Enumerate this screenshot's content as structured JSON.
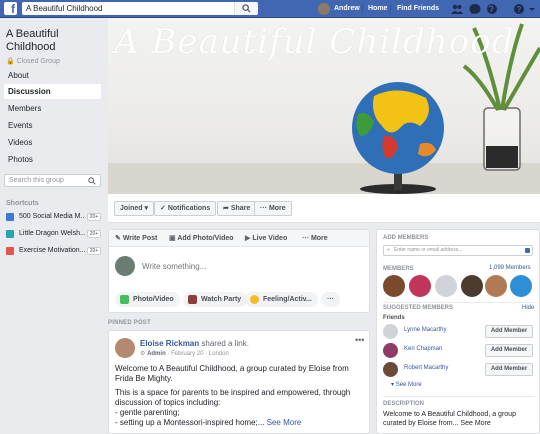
{
  "topbar": {
    "search_value": "A Beautiful Childhood",
    "user_name": "Andrew",
    "home_label": "Home",
    "find_friends_label": "Find Friends"
  },
  "sidebar": {
    "group_title": "A Beautiful Childhood",
    "privacy": "Closed Group",
    "nav": [
      "About",
      "Discussion",
      "Members",
      "Events",
      "Videos",
      "Photos"
    ],
    "search_placeholder": "Search this group",
    "shortcuts_title": "Shortcuts",
    "shortcuts": [
      {
        "label": "500 Social Media M...",
        "badge": "20+",
        "color": "#3b7bd6"
      },
      {
        "label": "Little Dragon Welsh...",
        "badge": "20+",
        "color": "#2aa3b6"
      },
      {
        "label": "Exercise Motivation...",
        "badge": "20+",
        "color": "#e6534a"
      }
    ]
  },
  "cover": {
    "title": "A Beautiful Childhood"
  },
  "actions": {
    "joined": "Joined",
    "notifications": "Notifications",
    "share": "Share",
    "more": "More"
  },
  "composer": {
    "tabs": [
      "Write Post",
      "Add Photo/Video",
      "Live Video",
      "More"
    ],
    "placeholder": "Write something...",
    "pills": [
      "Photo/Video",
      "Watch Party",
      "Feeling/Activ..."
    ]
  },
  "pinned": {
    "label": "PINNED POST",
    "author": "Eloise Rickman",
    "action": "shared a link.",
    "role": "Admin",
    "date": "February 20",
    "location": "London",
    "p1": "Welcome to A Beautiful Childhood, a group curated by Eloise from Frida Be Mighty.",
    "p2": "This is a space for parents to be inspired and empowered, through discussion of topics including:",
    "p3": "- gentle parenting;",
    "p4": "- setting up a Montessori-inspired home;...",
    "see_more": "See More"
  },
  "right": {
    "add_members_title": "ADD MEMBERS",
    "add_placeholder": "Enter name or email address...",
    "members_title": "MEMBERS",
    "members_count": "1,099 Members",
    "suggested_title": "SUGGESTED MEMBERS",
    "hide": "Hide",
    "friends_label": "Friends",
    "suggestions": [
      {
        "name": "Lynne Macarthy",
        "button": "Add Member"
      },
      {
        "name": "Ken Chapman",
        "button": "Add Member"
      },
      {
        "name": "Robert Macarthy",
        "button": "Add Member"
      }
    ],
    "see_more": "See More",
    "description_title": "DESCRIPTION",
    "description": "Welcome to A Beautiful Childhood, a group curated by Eloise from... See More"
  }
}
